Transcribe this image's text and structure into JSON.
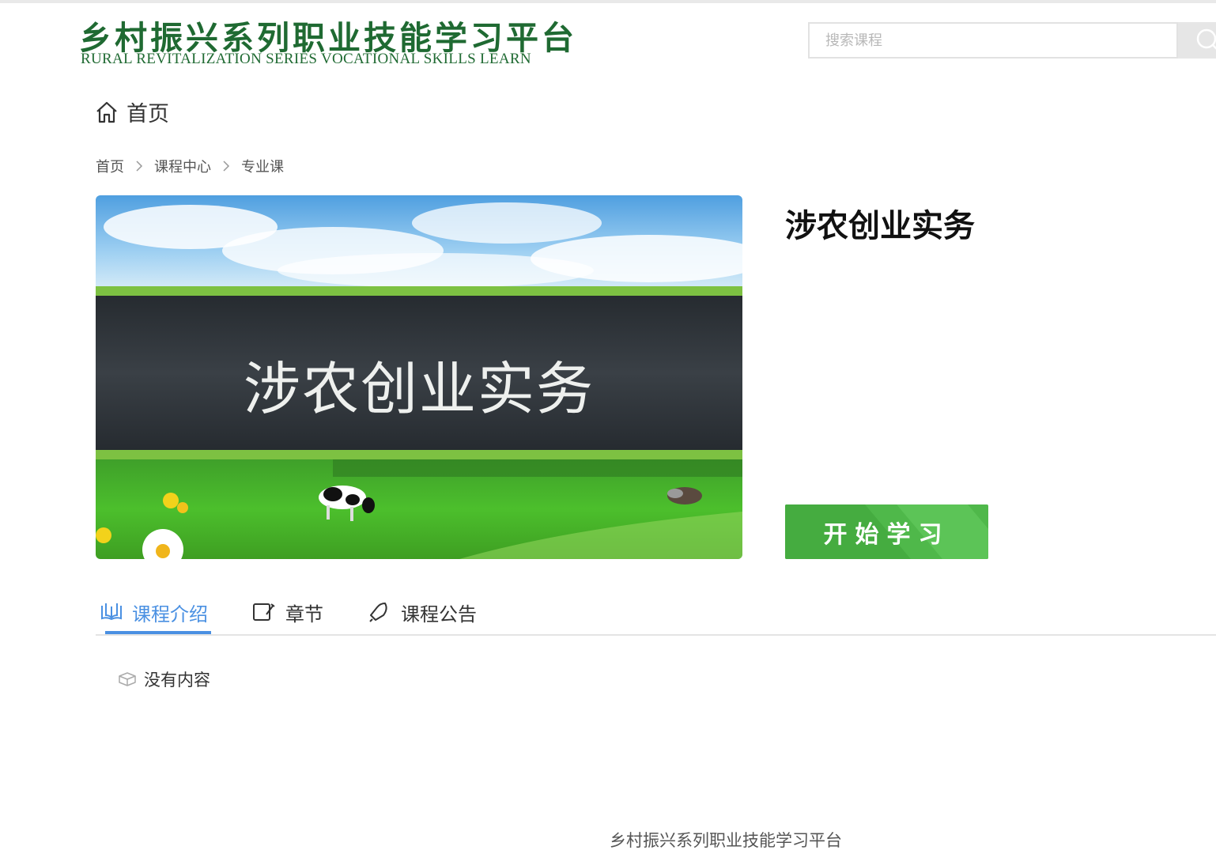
{
  "header": {
    "logo_cn": "乡村振兴系列职业技能学习平台",
    "logo_en": "RURAL REVITALIZATION SERIES VOCATIONAL SKILLS LEARN",
    "brand_color": "#1f6a32"
  },
  "search": {
    "placeholder": "搜索课程",
    "value": "",
    "icon": "search-icon"
  },
  "nav": {
    "home_label": "首页",
    "home_icon": "home-icon"
  },
  "breadcrumb": {
    "items": [
      "首页",
      "课程中心",
      "专业课"
    ],
    "separator_icon": "chevron-right-icon"
  },
  "course": {
    "banner_text": "涉农创业实务",
    "title": "涉农创业实务",
    "start_label": "开始学习",
    "start_color": "#4fb84a"
  },
  "tabs": {
    "items": [
      {
        "label": "课程介绍",
        "icon": "open-book-icon",
        "active": true
      },
      {
        "label": "章节",
        "icon": "notebook-pen-icon",
        "active": false
      },
      {
        "label": "课程公告",
        "icon": "bell-icon",
        "active": false
      }
    ],
    "accent_color": "#4a90e2"
  },
  "content": {
    "empty_label": "没有内容",
    "empty_icon": "empty-box-icon"
  },
  "footer": {
    "text": "乡村振兴系列职业技能学习平台"
  }
}
